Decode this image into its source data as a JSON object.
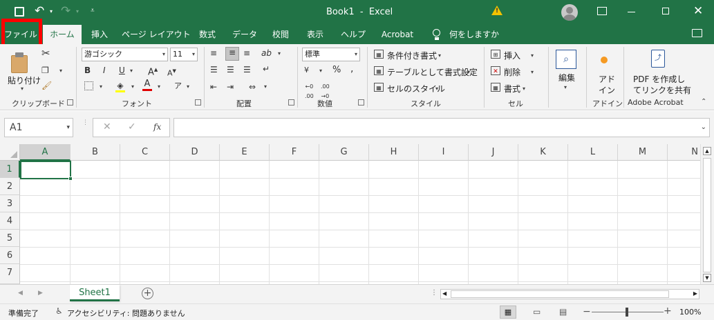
{
  "title_bar": {
    "title": "Book1  -  Excel",
    "save_icon": "save-icon",
    "undo_icon": "undo-icon",
    "redo_icon": "redo-icon",
    "warning_icon": "warning-icon"
  },
  "tabs": [
    {
      "label": "ファイル"
    },
    {
      "label": "ホーム"
    },
    {
      "label": "挿入"
    },
    {
      "label": "ページ レイアウト"
    },
    {
      "label": "数式"
    },
    {
      "label": "データ"
    },
    {
      "label": "校閲"
    },
    {
      "label": "表示"
    },
    {
      "label": "ヘルプ"
    },
    {
      "label": "Acrobat"
    }
  ],
  "tell_me": "何をしますか",
  "ribbon": {
    "clipboard": {
      "paste_label": "貼り付け",
      "group_label": "クリップボード"
    },
    "font": {
      "font_name": "游ゴシック",
      "font_size": "11",
      "bold": "B",
      "italic": "I",
      "underline": "U",
      "group_label": "フォント"
    },
    "alignment": {
      "group_label": "配置"
    },
    "number": {
      "format": "標準",
      "percent": "%",
      "group_label": "数値"
    },
    "styles": {
      "conditional": "条件付き書式",
      "as_table": "テーブルとして書式設定",
      "cell_styles": "セルのスタイル",
      "group_label": "スタイル"
    },
    "cells": {
      "insert": "挿入",
      "delete": "削除",
      "format": "書式",
      "group_label": "セル"
    },
    "editing": {
      "label": "編集"
    },
    "addins": {
      "label_line1": "アド",
      "label_line2": "イン",
      "group_label": "アドイン"
    },
    "acrobat": {
      "line1": "PDF を作成し",
      "line2": "てリンクを共有",
      "group_label": "Adobe Acrobat"
    }
  },
  "formula_bar": {
    "name_box": "A1",
    "fx": "fx",
    "formula": ""
  },
  "grid": {
    "columns": [
      "A",
      "B",
      "C",
      "D",
      "E",
      "F",
      "G",
      "H",
      "I",
      "J",
      "K",
      "L",
      "M",
      "N"
    ],
    "rows": [
      "1",
      "2",
      "3",
      "4",
      "5",
      "6",
      "7"
    ],
    "selected_cell": "A1"
  },
  "sheets": {
    "tabs": [
      "Sheet1"
    ],
    "active": "Sheet1"
  },
  "status": {
    "ready": "準備完了",
    "accessibility": "アクセシビリティ: 問題ありません",
    "zoom": "100%"
  },
  "colors": {
    "excel_green": "#217346",
    "highlight_box": "#ff0000",
    "ribbon_bg": "#f3f3f3"
  }
}
